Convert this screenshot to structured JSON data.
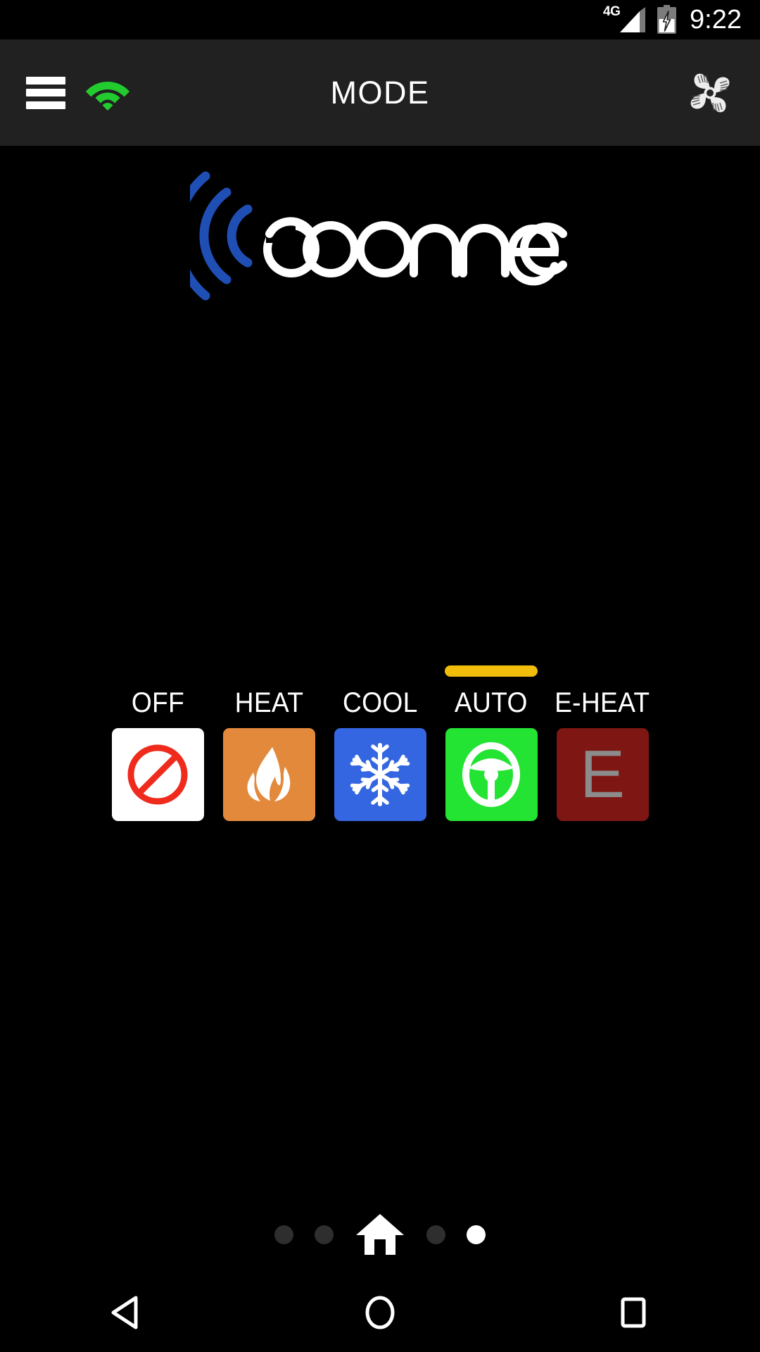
{
  "status_bar": {
    "network_label": "4G",
    "signal_icon": "signal-bars-icon",
    "battery_icon": "battery-charging-icon",
    "time": "9:22"
  },
  "app_bar": {
    "menu_icon": "hamburger-menu-icon",
    "wifi_icon": "wifi-icon",
    "wifi_color": "#22CC2E",
    "title": "MODE",
    "fan_icon": "fan-icon"
  },
  "logo": {
    "text": "connect",
    "signal_arc_color": "#1F4FB5",
    "wordmark_color": "#FFFFFF"
  },
  "modes": {
    "selected": "AUTO",
    "selection_bar_color": "#F0BD0B",
    "items": [
      {
        "label": "OFF",
        "icon": "no-entry-icon",
        "tile_color": "#FFFFFF",
        "icon_color": "#EE2B1C",
        "selected": false
      },
      {
        "label": "HEAT",
        "icon": "flame-icon",
        "tile_color": "#E3893C",
        "icon_color": "#FFFFFF",
        "selected": false
      },
      {
        "label": "COOL",
        "icon": "snowflake-icon",
        "tile_color": "#3366E0",
        "icon_color": "#FFFFFF",
        "selected": false
      },
      {
        "label": "AUTO",
        "icon": "steering-wheel-icon",
        "tile_color": "#23E333",
        "icon_color": "#FFFFFF",
        "selected": true
      },
      {
        "label": "E-HEAT",
        "icon": "letter-e-icon",
        "tile_color": "#7E1713",
        "icon_color": "#8C8C8C",
        "selected": false
      }
    ]
  },
  "pager": {
    "items": [
      {
        "type": "dot",
        "active": false
      },
      {
        "type": "dot",
        "active": false
      },
      {
        "type": "home",
        "active": false
      },
      {
        "type": "dot",
        "active": false
      },
      {
        "type": "dot",
        "active": true
      }
    ]
  },
  "nav_bar": {
    "back_icon": "back-triangle-icon",
    "home_icon": "home-circle-icon",
    "recents_icon": "recents-square-icon"
  }
}
